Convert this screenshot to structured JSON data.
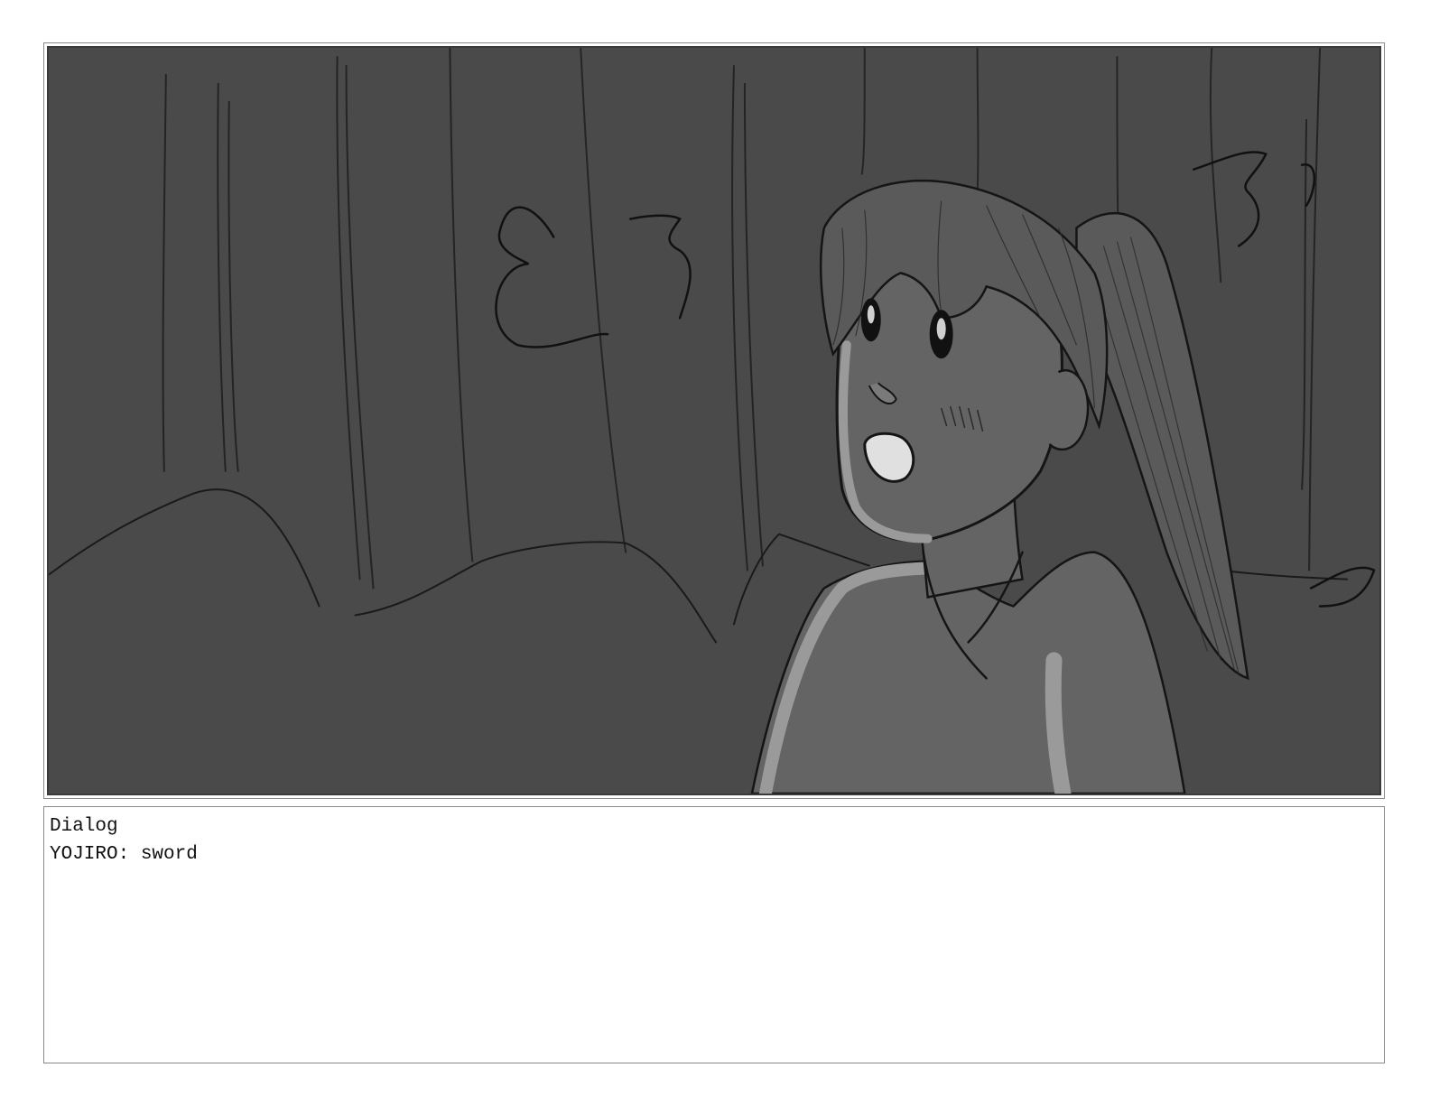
{
  "storyboard": {
    "panel": {
      "illustration": "storyboard-sketch",
      "background_color": "#4a4a4a",
      "figure_color": "#646464",
      "highlight_color": "#9a9a9a"
    },
    "dialog": {
      "heading": "Dialog",
      "line_1": "YOJIRO: sword"
    }
  }
}
